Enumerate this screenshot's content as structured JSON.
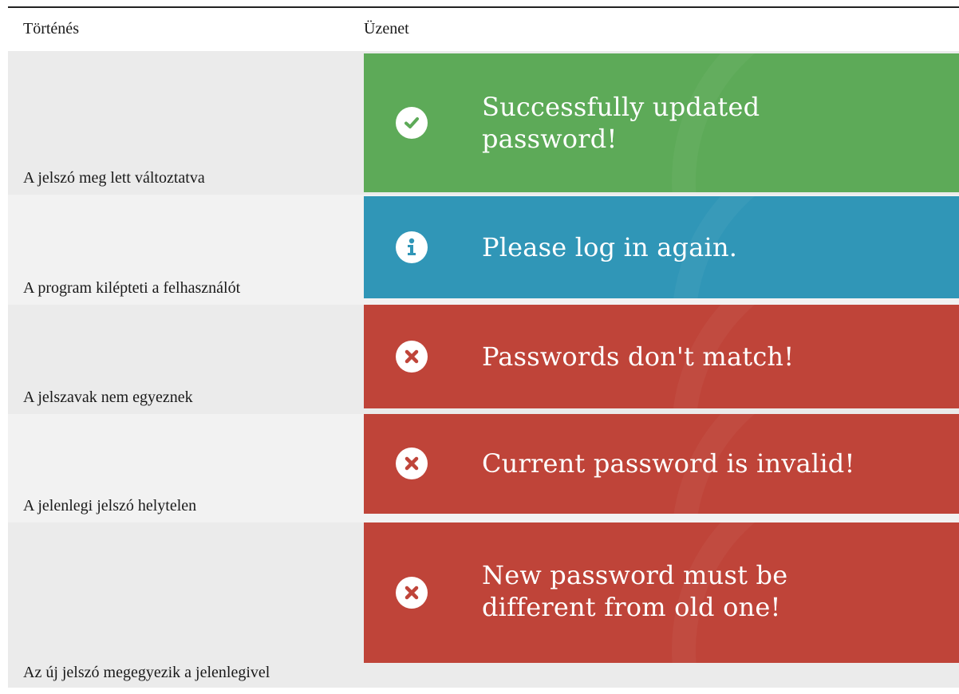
{
  "table": {
    "headers": {
      "event": "Történés",
      "message": "Üzenet"
    },
    "rows": [
      {
        "event": "A jelszó meg lett változtatva",
        "message_line1": "Successfully updated",
        "message_line2": "password!",
        "type": "success",
        "icon": "check-circle-icon",
        "color": "#5daa58"
      },
      {
        "event": "A program kilépteti a felhasználót",
        "message_line1": "Please log in again.",
        "type": "info",
        "icon": "info-circle-icon",
        "color": "#3096b7"
      },
      {
        "event": "A jelszavak nem egyeznek",
        "message_line1": "Passwords don't match!",
        "type": "error",
        "icon": "times-circle-icon",
        "color": "#bf4439"
      },
      {
        "event": "A jelenlegi jelszó helytelen",
        "message_line1": "Current password is invalid!",
        "type": "error",
        "icon": "times-circle-icon",
        "color": "#bf4439"
      },
      {
        "event": "Az új jelszó megegyezik a jelenlegivel",
        "message_line1": "New password must be",
        "message_line2": "different from old one!",
        "type": "error",
        "icon": "times-circle-icon",
        "color": "#bf4439"
      }
    ]
  }
}
